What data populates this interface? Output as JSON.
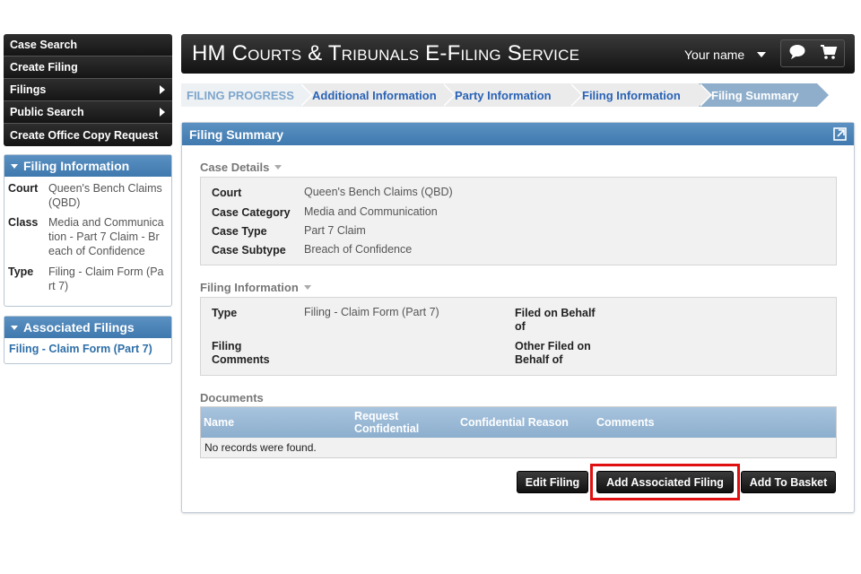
{
  "nav": {
    "items": [
      {
        "label": "Case Search",
        "arrow": false
      },
      {
        "label": "Create Filing",
        "arrow": false
      },
      {
        "label": "Filings",
        "arrow": true
      },
      {
        "label": "Public Search",
        "arrow": true
      },
      {
        "label": "Create Office Copy Request",
        "arrow": false
      }
    ]
  },
  "filing_info_panel": {
    "title": "Filing Information",
    "rows": [
      {
        "label": "Court",
        "value": "Queen's Bench Claims (QBD)"
      },
      {
        "label": "Class",
        "value": "Media and Communication - Part 7 Claim - Breach of Confidence"
      },
      {
        "label": "Type",
        "value": "Filing - Claim Form (Part 7)"
      }
    ]
  },
  "associated_filings_panel": {
    "title": "Associated Filings",
    "link": "Filing - Claim Form (Part 7)"
  },
  "header": {
    "title": "HM Courts & Tribunals E-Filing Service",
    "user_name": "Your name",
    "icons": [
      "chat-icon",
      "cart-icon"
    ]
  },
  "progress": {
    "label": "FILING PROGRESS",
    "steps": [
      "Additional Information",
      "Party Information",
      "Filing Information",
      "Filing Summary"
    ],
    "active_index": 3
  },
  "summary": {
    "title": "Filing Summary",
    "case_details": {
      "title": "Case Details",
      "rows": [
        {
          "label": "Court",
          "value": "Queen's Bench Claims (QBD)"
        },
        {
          "label": "Case Category",
          "value": "Media and Communication"
        },
        {
          "label": "Case Type",
          "value": "Part 7 Claim"
        },
        {
          "label": "Case Subtype",
          "value": "Breach of Confidence"
        }
      ]
    },
    "filing_information": {
      "title": "Filing Information",
      "type_label": "Type",
      "type_value": "Filing - Claim Form (Part 7)",
      "comments_label": "Filing Comments",
      "behalf_label": "Filed on Behalf of",
      "other_behalf_label": "Other Filed on Behalf of"
    },
    "documents": {
      "title": "Documents",
      "columns": [
        "Name",
        "Request Confidential",
        "Confidential Reason",
        "Comments"
      ],
      "empty_text": "No records were found."
    },
    "buttons": {
      "edit": "Edit Filing",
      "add_associated": "Add Associated Filing",
      "add_basket": "Add To Basket"
    }
  },
  "colors": {
    "highlight": "#e01010",
    "panel_blue": "#4a84b8",
    "link_blue": "#2a63b6"
  }
}
